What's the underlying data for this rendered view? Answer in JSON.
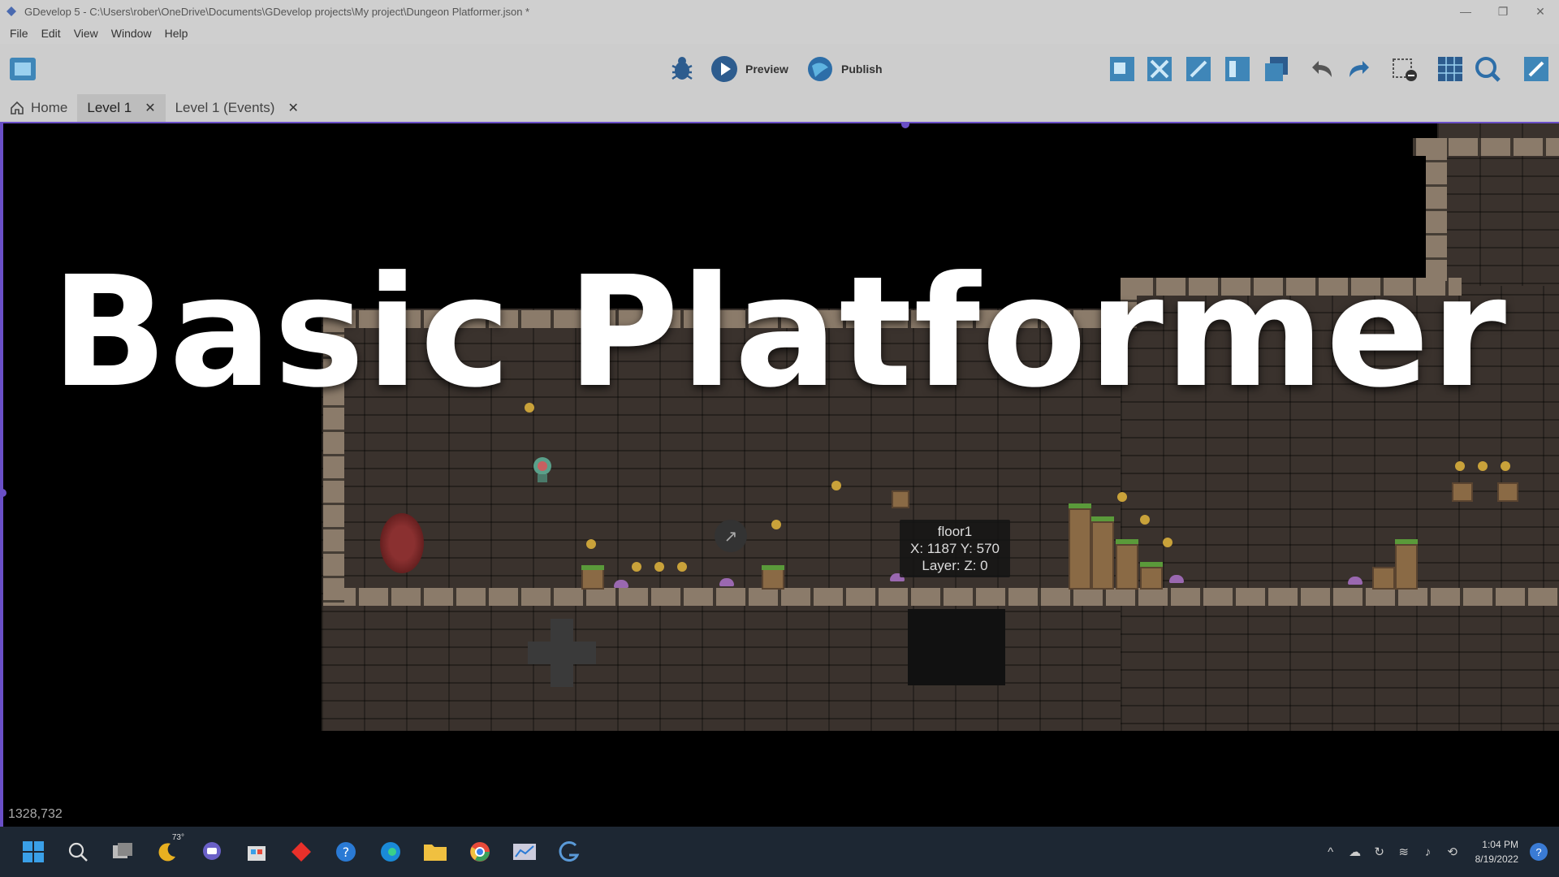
{
  "window": {
    "title": "GDevelop 5 - C:\\Users\\rober\\OneDrive\\Documents\\GDevelop projects\\My project\\Dungeon Platformer.json *",
    "minimize": "—",
    "maximize": "❐",
    "close": "✕"
  },
  "menu": {
    "items": [
      "File",
      "Edit",
      "View",
      "Window",
      "Help"
    ]
  },
  "toolbar": {
    "preview_label": "Preview",
    "publish_label": "Publish"
  },
  "tabs": [
    {
      "label": "Home"
    },
    {
      "label": "Level 1",
      "active": true
    },
    {
      "label": "Level 1 (Events)"
    }
  ],
  "tab_close_glyph": "✕",
  "scene": {
    "cursor_coords": "1328,732",
    "tooltip": {
      "object": "floor1",
      "position": "X: 1187  Y: 570",
      "layer": "Layer:   Z: 0"
    },
    "overlay_title": "Basic Platformer"
  },
  "taskbar": {
    "weather_temp": "73°",
    "clock_time": "1:04 PM",
    "clock_date": "8/19/2022"
  },
  "colors": {
    "accent": "#6a4fc7",
    "taskbar": "#1d2733"
  }
}
